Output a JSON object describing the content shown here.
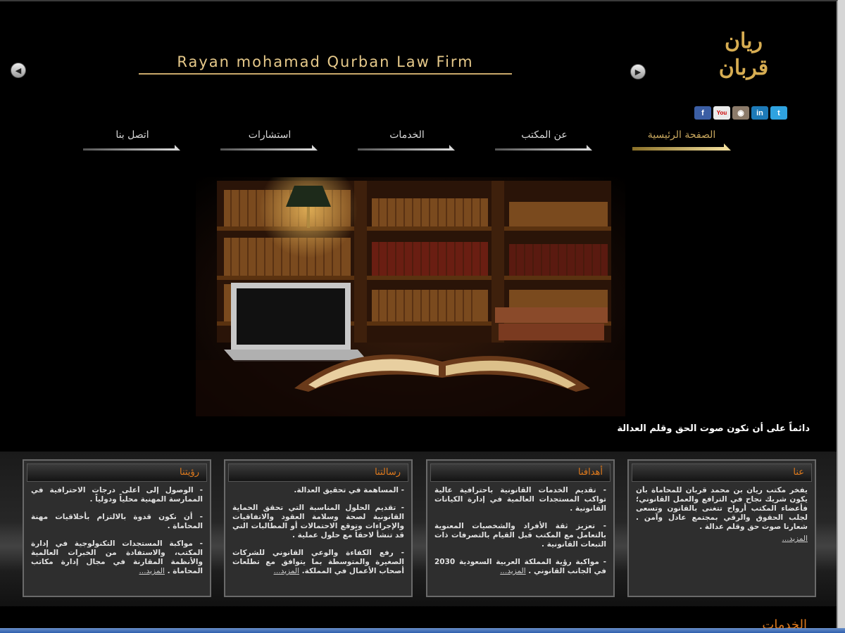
{
  "header": {
    "firm_name": "Rayan mohamad Qurban Law Firm",
    "logo_text": "ريان قربان",
    "prev_arrow": "◀",
    "next_arrow": "▶"
  },
  "social": [
    {
      "name": "facebook",
      "label": "f"
    },
    {
      "name": "youtube",
      "label": "You"
    },
    {
      "name": "instagram",
      "label": "◉"
    },
    {
      "name": "linkedin",
      "label": "in"
    },
    {
      "name": "twitter",
      "label": "t"
    }
  ],
  "nav": [
    {
      "label": "الصفحة الرئيسية",
      "active": true
    },
    {
      "label": "عن المكتب"
    },
    {
      "label": "الخدمات"
    },
    {
      "label": "استشارات"
    },
    {
      "label": "اتصل بنا"
    }
  ],
  "hero": {
    "slogan": "دائماً على أن نكون صوت الحق وقلم العدالة"
  },
  "cards": [
    {
      "title": "عنا",
      "paragraphs": [
        "يفخر مكتب ريان بن محمد قربان للمحاماة بأن يكون شريك نجاح في الترافع والعمل القانوني؛ فأعضاء المكتب أرواح تتغنى بالقانون وتسعى لجلب الحقوق والرقي بمجتمع عادل وآمن . شعارنا صوت حق وقلم عدالة ."
      ],
      "more": "المزيد..."
    },
    {
      "title": "أهدافنا",
      "paragraphs": [
        "- تقديم الخدمات القانونية باحترافية عالية تواكب المستجدات العالمية في إدارة الكيانات القانونية .",
        "- تعزيز ثقة الأفراد والشخصيات المعنوية بالتعامل مع المكتب قبل القيام بالتصرفات ذات التبعات القانونية .",
        "- مواكبة رؤية المملكة العربية السعودية 2030 في الجانب القانوني ."
      ],
      "more": "المزيد..."
    },
    {
      "title": "رسالتنا",
      "paragraphs": [
        "- المساهمة في تحقيق العدالة.",
        "- تقديم الحلول المناسبة التي تحقق الحماية القانونية لصحة وسلامة العقود والاتفاقيات والإجراءات وتوقع الاحتمالات أو المطالبات التي قد تنشأ لاحقاً مع حلول عملية .",
        "- رفع الكفاءة والوعي القانوني للشركات الصغيرة والمتوسطة بما يتوافق مع تطلعات أصحاب الأعمال في المملكة."
      ],
      "more": "المزيد..."
    },
    {
      "title": "رؤيتنا",
      "paragraphs": [
        "- الوصول إلى أعلى درجات الاحترافية في الممارسة المهنية محلياً ودولياً .",
        "- أن نكون قدوة بالالتزام بأخلاقيات مهنة المحاماة .",
        "- مواكبة المستجدات التكنولوجية في إدارة المكتب، والاستفادة من الخبرات العالمية والأنظمة المقارنة في مجال إدارة مكاتب المحاماة ."
      ],
      "more": "المزيد..."
    }
  ],
  "services_title": "الخدمات",
  "colors": {
    "gold": "#c8a75e",
    "accent_orange": "#e07a1c",
    "background": "#000000"
  }
}
